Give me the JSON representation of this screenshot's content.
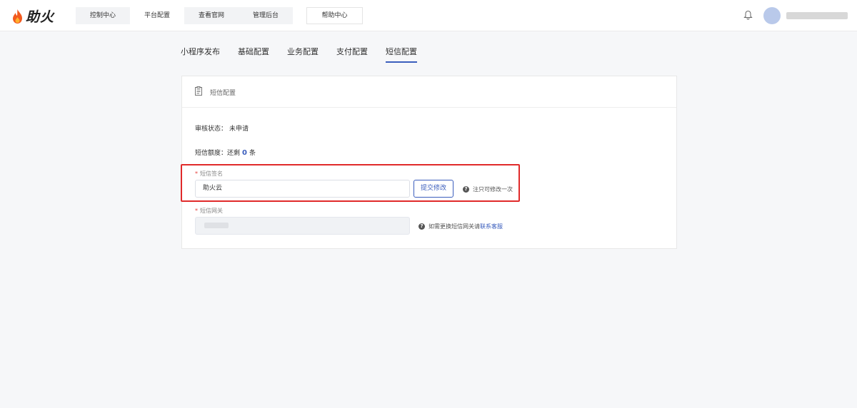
{
  "brand": {
    "name": "助火"
  },
  "nav": {
    "items": [
      {
        "label": "控制中心",
        "active": false
      },
      {
        "label": "平台配置",
        "active": true
      },
      {
        "label": "查看官网",
        "active": false
      },
      {
        "label": "管理后台",
        "active": false
      }
    ],
    "help_label": "帮助中心"
  },
  "tabs": [
    {
      "label": "小程序发布",
      "active": false
    },
    {
      "label": "基础配置",
      "active": false
    },
    {
      "label": "业务配置",
      "active": false
    },
    {
      "label": "支付配置",
      "active": false
    },
    {
      "label": "短信配置",
      "active": true
    }
  ],
  "card": {
    "title": "短信配置",
    "status_label": "审核状态：",
    "status_value": "未申请",
    "quota_prefix": "短信额度：还剩",
    "quota_count": "0",
    "quota_suffix": "条",
    "signature": {
      "required_mark": "*",
      "label": "短信签名",
      "value": "助火云",
      "submit_label": "提交修改",
      "hint": "注只可修改一次"
    },
    "gateway": {
      "required_mark": "*",
      "label": "短信网关",
      "hint_prefix": "如需更换短信网关请",
      "hint_link": "联系客服"
    }
  },
  "colors": {
    "accent": "#3b5ebd",
    "highlight": "#e02a2a",
    "required": "#e5403b"
  },
  "icons": {
    "logo": "flame-icon",
    "bell": "bell-icon",
    "card": "clipboard-icon",
    "hint": "question-circle-icon"
  }
}
